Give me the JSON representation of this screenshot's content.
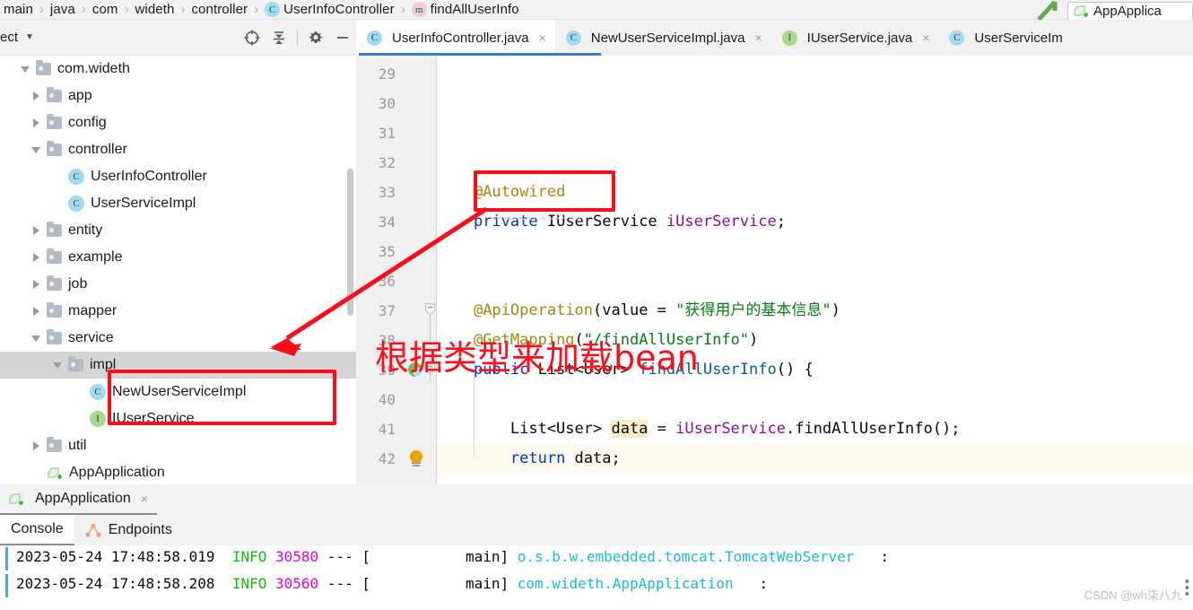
{
  "breadcrumb": {
    "items": [
      {
        "label": "main",
        "icon": null
      },
      {
        "label": "java",
        "icon": null
      },
      {
        "label": "com",
        "icon": null
      },
      {
        "label": "wideth",
        "icon": null
      },
      {
        "label": "controller",
        "icon": null
      },
      {
        "label": "UserInfoController",
        "icon": "class-icon",
        "icon_glyph": "C"
      },
      {
        "label": "findAllUserInfo",
        "icon": "method-icon",
        "icon_glyph": "m"
      }
    ],
    "separator": "›"
  },
  "toolbar_right": {
    "run_config_name": "AppApplica",
    "run_config_icon": "spring-boot-icon",
    "green_arrow_icon": "green-arrow-icon"
  },
  "project_panel": {
    "title": "ect",
    "caret_icon": "chevron-down-icon",
    "buttons": [
      {
        "name": "locate-icon",
        "title": "Select Opened File"
      },
      {
        "name": "collapse-all-icon",
        "title": "Collapse All"
      },
      {
        "name": "gear-icon",
        "title": "Settings"
      },
      {
        "name": "minimize-icon",
        "title": "Hide"
      }
    ],
    "tree": [
      {
        "label": "com.wideth",
        "indent": 0,
        "twisty": "down",
        "icon": "folder-icon",
        "selected": false
      },
      {
        "label": "app",
        "indent": 1,
        "twisty": "right",
        "icon": "folder-icon",
        "selected": false
      },
      {
        "label": "config",
        "indent": 1,
        "twisty": "right",
        "icon": "folder-icon",
        "selected": false
      },
      {
        "label": "controller",
        "indent": 1,
        "twisty": "down",
        "icon": "folder-icon",
        "selected": false
      },
      {
        "label": "UserInfoController",
        "indent": 2,
        "twisty": "none",
        "icon": "class-icon",
        "icon_glyph": "C",
        "selected": false
      },
      {
        "label": "UserServiceImpl",
        "indent": 2,
        "twisty": "none",
        "icon": "class-icon",
        "icon_glyph": "C",
        "selected": false
      },
      {
        "label": "entity",
        "indent": 1,
        "twisty": "right",
        "icon": "folder-icon",
        "selected": false
      },
      {
        "label": "example",
        "indent": 1,
        "twisty": "right",
        "icon": "folder-icon",
        "selected": false
      },
      {
        "label": "job",
        "indent": 1,
        "twisty": "right",
        "icon": "folder-icon",
        "selected": false
      },
      {
        "label": "mapper",
        "indent": 1,
        "twisty": "right",
        "icon": "folder-icon",
        "selected": false
      },
      {
        "label": "service",
        "indent": 1,
        "twisty": "down",
        "icon": "folder-icon",
        "selected": false
      },
      {
        "label": "impl",
        "indent": 2,
        "twisty": "down",
        "icon": "folder-icon",
        "selected": true
      },
      {
        "label": "NewUserServiceImpl",
        "indent": 3,
        "twisty": "none",
        "icon": "class-icon",
        "icon_glyph": "C",
        "selected": false
      },
      {
        "label": "IUserService",
        "indent": 3,
        "twisty": "none",
        "icon": "interface-icon",
        "icon_glyph": "I",
        "selected": false
      },
      {
        "label": "util",
        "indent": 1,
        "twisty": "right",
        "icon": "folder-icon",
        "selected": false
      },
      {
        "label": "AppApplication",
        "indent": 1,
        "twisty": "none",
        "icon": "spring-class-icon",
        "selected": false
      }
    ]
  },
  "editor_tabs": [
    {
      "label": "UserInfoController.java",
      "icon_glyph": "C",
      "icon_kind": "class",
      "active": true,
      "close": "×"
    },
    {
      "label": "NewUserServiceImpl.java",
      "icon_glyph": "C",
      "icon_kind": "class",
      "active": false,
      "close": "×"
    },
    {
      "label": "IUserService.java",
      "icon_glyph": "I",
      "icon_kind": "interface",
      "active": false,
      "close": "×"
    },
    {
      "label": "UserServiceIm",
      "icon_glyph": "C",
      "icon_kind": "class",
      "active": false,
      "close": ""
    }
  ],
  "editor": {
    "first_line": 29,
    "lines": [
      {
        "num": 29,
        "tokens": [],
        "gutter": null,
        "caret_row": false
      },
      {
        "num": 30,
        "tokens": [],
        "gutter": null,
        "caret_row": false
      },
      {
        "num": 31,
        "tokens": [],
        "gutter": null,
        "caret_row": false
      },
      {
        "num": 32,
        "tokens": [],
        "gutter": null,
        "caret_row": false
      },
      {
        "num": 33,
        "tokens": [
          {
            "t": "    ",
            "c": "plain"
          },
          {
            "t": "@Autowired",
            "c": "ann"
          }
        ],
        "gutter": null,
        "caret_row": false
      },
      {
        "num": 34,
        "tokens": [
          {
            "t": "    ",
            "c": "plain"
          },
          {
            "t": "private",
            "c": "kw"
          },
          {
            "t": " IUserService ",
            "c": "plain"
          },
          {
            "t": "iUserService",
            "c": "fld"
          },
          {
            "t": ";",
            "c": "plain"
          }
        ],
        "gutter": null,
        "caret_row": false
      },
      {
        "num": 35,
        "tokens": [],
        "gutter": null,
        "caret_row": false
      },
      {
        "num": 36,
        "tokens": [],
        "gutter": null,
        "caret_row": false
      },
      {
        "num": 37,
        "tokens": [
          {
            "t": "    ",
            "c": "plain"
          },
          {
            "t": "@ApiOperation",
            "c": "ann"
          },
          {
            "t": "(value = ",
            "c": "plain"
          },
          {
            "t": "\"获得用户的基本信息\"",
            "c": "str"
          },
          {
            "t": ")",
            "c": "plain"
          }
        ],
        "gutter": "fold-collapse",
        "caret_row": false
      },
      {
        "num": 38,
        "tokens": [
          {
            "t": "    ",
            "c": "plain"
          },
          {
            "t": "@GetMapping",
            "c": "ann"
          },
          {
            "t": "(",
            "c": "plain"
          },
          {
            "t": "\"/findAllUserInfo\"",
            "c": "str"
          },
          {
            "t": ")",
            "c": "plain"
          }
        ],
        "gutter": null,
        "caret_row": false
      },
      {
        "num": 39,
        "tokens": [
          {
            "t": "    ",
            "c": "plain"
          },
          {
            "t": "public",
            "c": "kw"
          },
          {
            "t": " List<User> ",
            "c": "plain"
          },
          {
            "t": "findAllUserInfo",
            "c": "mth"
          },
          {
            "t": "() {",
            "c": "plain"
          }
        ],
        "gutter": "spring-bean",
        "caret_row": false
      },
      {
        "num": 40,
        "tokens": [],
        "gutter": null,
        "caret_row": false
      },
      {
        "num": 41,
        "tokens": [
          {
            "t": "        List<User> ",
            "c": "plain"
          },
          {
            "t": "data",
            "c": "hl"
          },
          {
            "t": " = ",
            "c": "plain"
          },
          {
            "t": "iUserService",
            "c": "fld"
          },
          {
            "t": ".findAllUserInfo();",
            "c": "plain"
          }
        ],
        "gutter": null,
        "caret_row": false
      },
      {
        "num": 42,
        "tokens": [
          {
            "t": "        ",
            "c": "plain"
          },
          {
            "t": "return",
            "c": "kw"
          },
          {
            "t": " data;",
            "c": "plain"
          }
        ],
        "gutter": "intention-bulb",
        "caret_row": true
      }
    ]
  },
  "run_panel": {
    "tab": {
      "label": "AppApplication",
      "icon": "spring-boot-icon",
      "close": "×"
    },
    "sub_tabs": [
      {
        "label": "Console",
        "icon": null,
        "active": true
      },
      {
        "label": "Endpoints",
        "icon": "endpoints-icon",
        "active": false
      }
    ],
    "console_lines": [
      {
        "timestamp": "2023-05-24 17:48:58.019",
        "level": "INFO",
        "pid": "30580",
        "dash": "---",
        "thread": "[           main]",
        "logger": "o.s.b.w.embedded.tomcat.TomcatWebServer",
        "tail": ":"
      },
      {
        "timestamp": "2023-05-24 17:48:58.208",
        "level": "INFO",
        "pid": "30560",
        "dash": "---",
        "thread": "[           main]",
        "logger": "com.wideth.AppApplication",
        "tail": ":"
      }
    ]
  },
  "annotations": {
    "color": "#fd0d1b",
    "callout_text": "根据类型来加载bean",
    "boxes": [
      {
        "name": "autowired-highlight-box"
      },
      {
        "name": "new-user-service-impl-highlight-box"
      }
    ],
    "arrow": {
      "name": "annotation-arrow",
      "from": "@Autowired",
      "to": "NewUserServiceImpl"
    }
  },
  "watermark": {
    "text": "CSDN @wh柒八九"
  }
}
